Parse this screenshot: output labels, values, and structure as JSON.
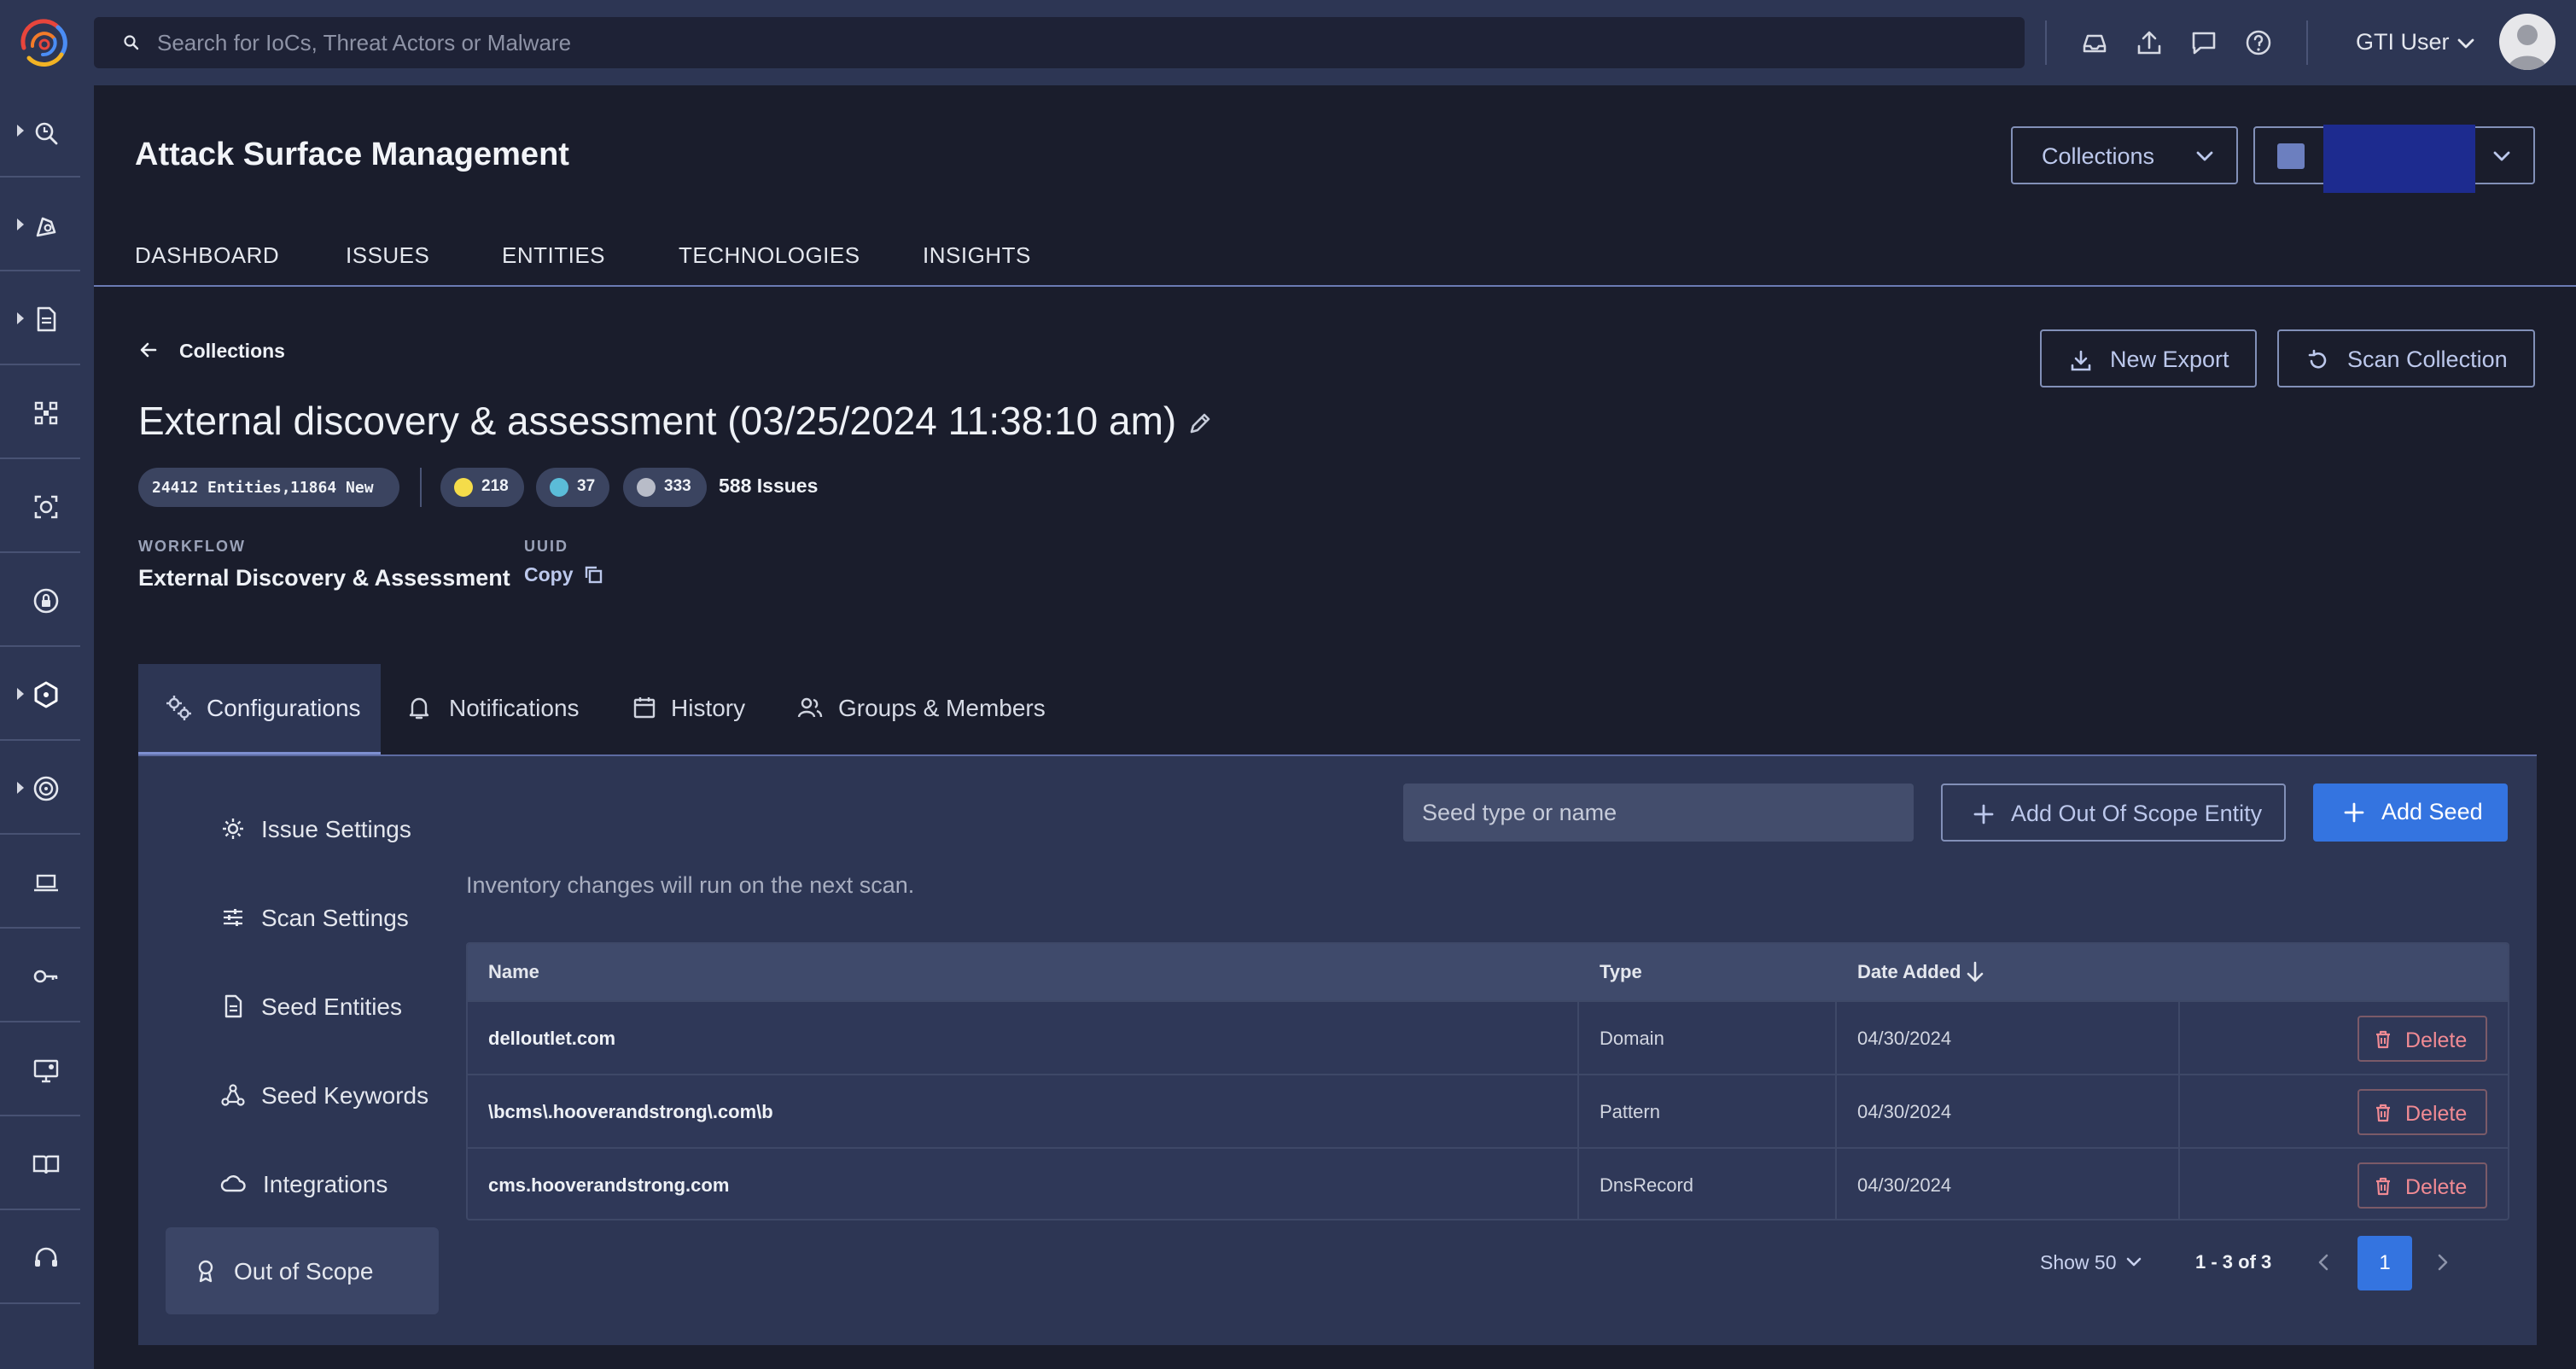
{
  "topbar": {
    "search_placeholder": "Search for IoCs, Threat Actors or Malware",
    "user_name": "GTI User"
  },
  "header": {
    "page_title": "Attack Surface Management",
    "collections_button": "Collections"
  },
  "nav_tabs": [
    "DASHBOARD",
    "ISSUES",
    "ENTITIES",
    "TECHNOLOGIES",
    "INSIGHTS"
  ],
  "breadcrumb": {
    "back_label": "Collections"
  },
  "actions": {
    "new_export": "New Export",
    "scan_collection": "Scan Collection"
  },
  "collection": {
    "title": "External discovery & assessment (03/25/2024 11:38:10 am)",
    "entities_count": "24412 Entities,",
    "entities_new": "11864 New",
    "severity_counts": [
      {
        "value": "218",
        "color": "#f5dc4a"
      },
      {
        "value": "37",
        "color": "#5bbcd8"
      },
      {
        "value": "333",
        "color": "#b8bcc8"
      }
    ],
    "issues_total": "588 Issues",
    "workflow_label": "WORKFLOW",
    "workflow_value": "External Discovery & Assessment",
    "uuid_label": "UUID",
    "uuid_copy": "Copy"
  },
  "tabs": [
    {
      "label": "Configurations",
      "icon": "gears-icon",
      "active": true
    },
    {
      "label": "Notifications",
      "icon": "bell-icon",
      "active": false
    },
    {
      "label": "History",
      "icon": "calendar-icon",
      "active": false
    },
    {
      "label": "Groups & Members",
      "icon": "people-icon",
      "active": false
    }
  ],
  "config_menu": [
    {
      "label": "Issue Settings",
      "icon": "gear-icon"
    },
    {
      "label": "Scan Settings",
      "icon": "sliders-icon"
    },
    {
      "label": "Seed Entities",
      "icon": "document-icon"
    },
    {
      "label": "Seed Keywords",
      "icon": "nodes-icon"
    },
    {
      "label": "Integrations",
      "icon": "cloud-icon"
    },
    {
      "label": "Out of Scope",
      "icon": "award-icon",
      "active": true
    }
  ],
  "panel": {
    "seed_placeholder": "Seed type or name",
    "add_out_of_scope": "Add Out Of Scope Entity",
    "add_seed": "Add Seed",
    "note": "Inventory changes will run on the next scan."
  },
  "table": {
    "columns": [
      "Name",
      "Type",
      "Date Added"
    ],
    "sort_column": "Date Added",
    "rows": [
      {
        "name": "delloutlet.com",
        "type": "Domain",
        "date": "04/30/2024",
        "action": "Delete"
      },
      {
        "name": "\\bcms\\.hooverandstrong\\.com\\b",
        "type": "Pattern",
        "date": "04/30/2024",
        "action": "Delete"
      },
      {
        "name": "cms.hooverandstrong.com",
        "type": "DnsRecord",
        "date": "04/30/2024",
        "action": "Delete"
      }
    ]
  },
  "pagination": {
    "show": "Show 50",
    "range": "1 - 3 of 3",
    "current_page": "1"
  }
}
